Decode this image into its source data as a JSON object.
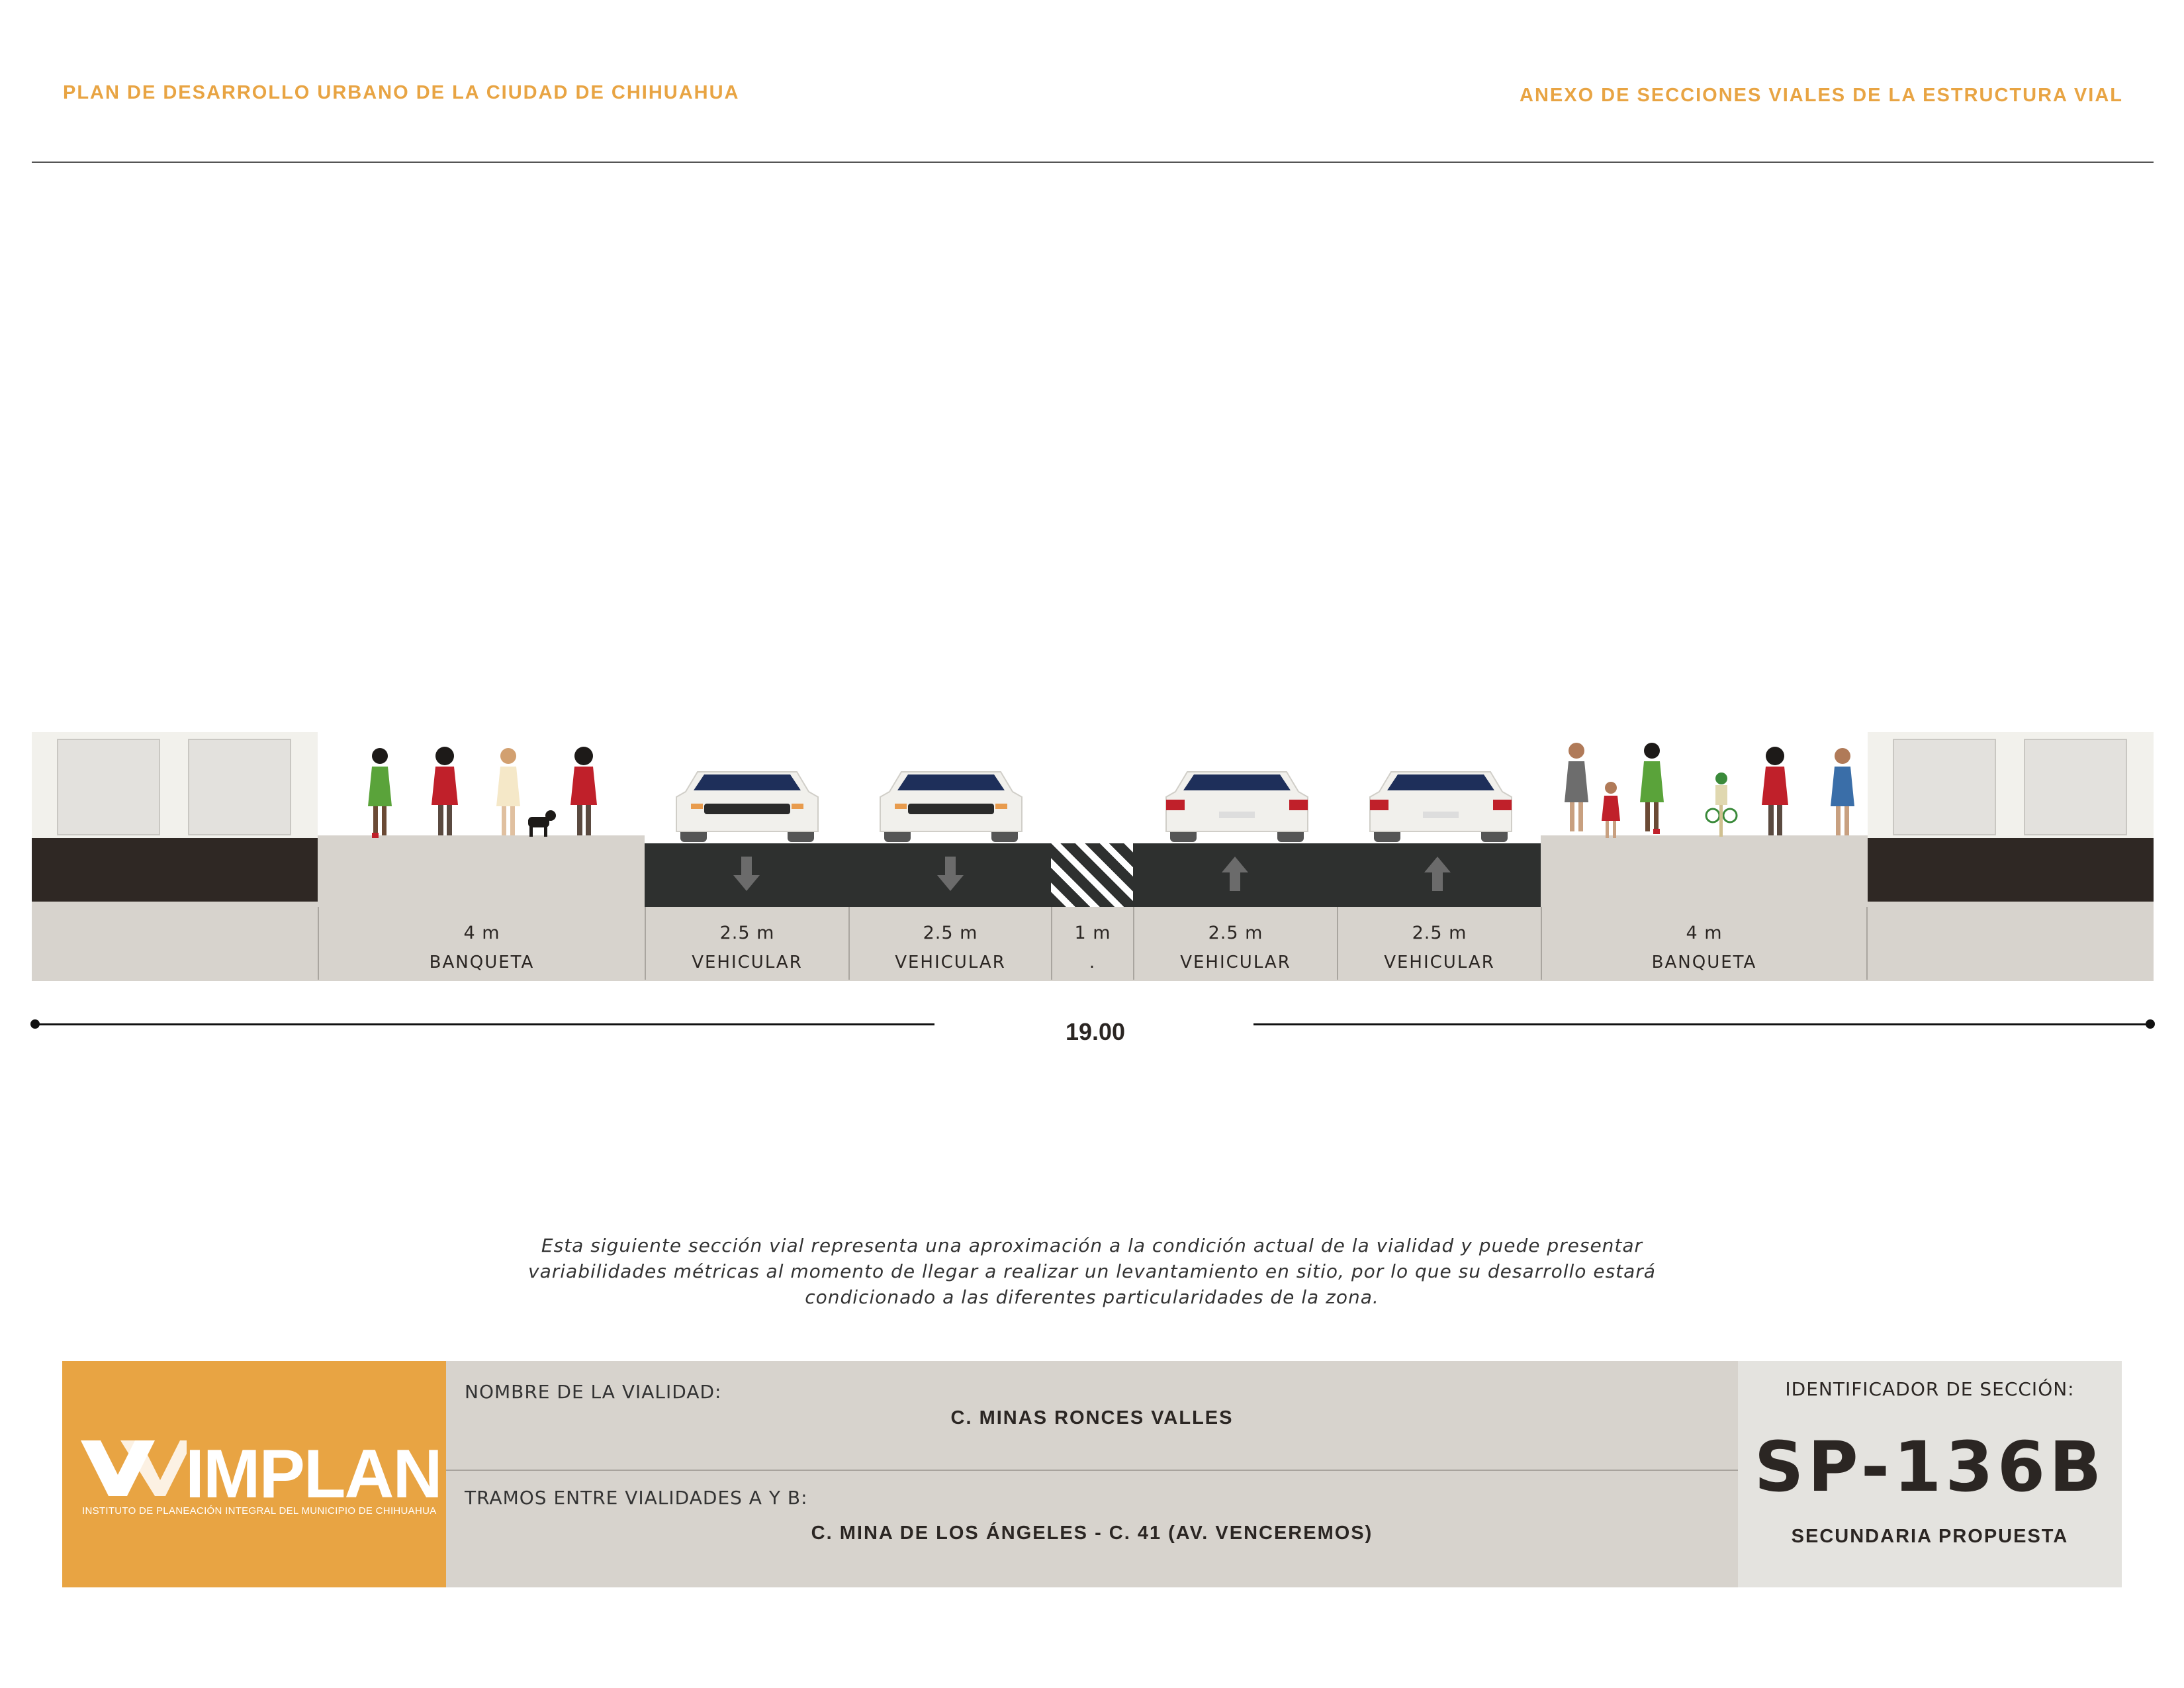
{
  "header": {
    "left_title": "PLAN DE DESARROLLO URBANO DE LA CIUDAD DE CHIHUAHUA",
    "right_title": "ANEXO DE SECCIONES VIALES DE LA ESTRUCTURA VIAL"
  },
  "section": {
    "lanes": [
      {
        "width": "4 m",
        "name": "BANQUETA"
      },
      {
        "width": "2.5 m",
        "name": "VEHICULAR"
      },
      {
        "width": "2.5 m",
        "name": "VEHICULAR"
      },
      {
        "width": "1 m",
        "name": "."
      },
      {
        "width": "2.5 m",
        "name": "VEHICULAR"
      },
      {
        "width": "2.5 m",
        "name": "VEHICULAR"
      },
      {
        "width": "4 m",
        "name": "BANQUETA"
      }
    ],
    "total_width": "19.00"
  },
  "note": "Esta siguiente sección vial representa una aproximación a la condición actual de la vialidad y puede presentar variabilidades métricas al momento de llegar a realizar un levantamiento en sitio, por lo que su desarrollo estará condicionado a las diferentes particularidades de la zona.",
  "footer": {
    "logo_text": "IMPLAN",
    "logo_subtitle": "INSTITUTO DE PLANEACIÓN INTEGRAL DEL MUNICIPIO DE CHIHUAHUA",
    "road_name_label": "NOMBRE DE LA VIALIDAD:",
    "road_name": "C. MINAS RONCES VALLES",
    "segment_label": "TRAMOS ENTRE VIALIDADES A Y B:",
    "segment": "C. MINA DE LOS ÁNGELES - C. 41 (AV. VENCEREMOS)",
    "id_label": "IDENTIFICADOR DE SECCIÓN:",
    "id_code": "SP-136B",
    "id_type": "SECUNDARIA PROPUESTA"
  },
  "colors": {
    "accent": "#e8a443",
    "asphalt": "#2e302f",
    "sidewalk": "#d7d3cd",
    "building_base": "#2f2824"
  }
}
